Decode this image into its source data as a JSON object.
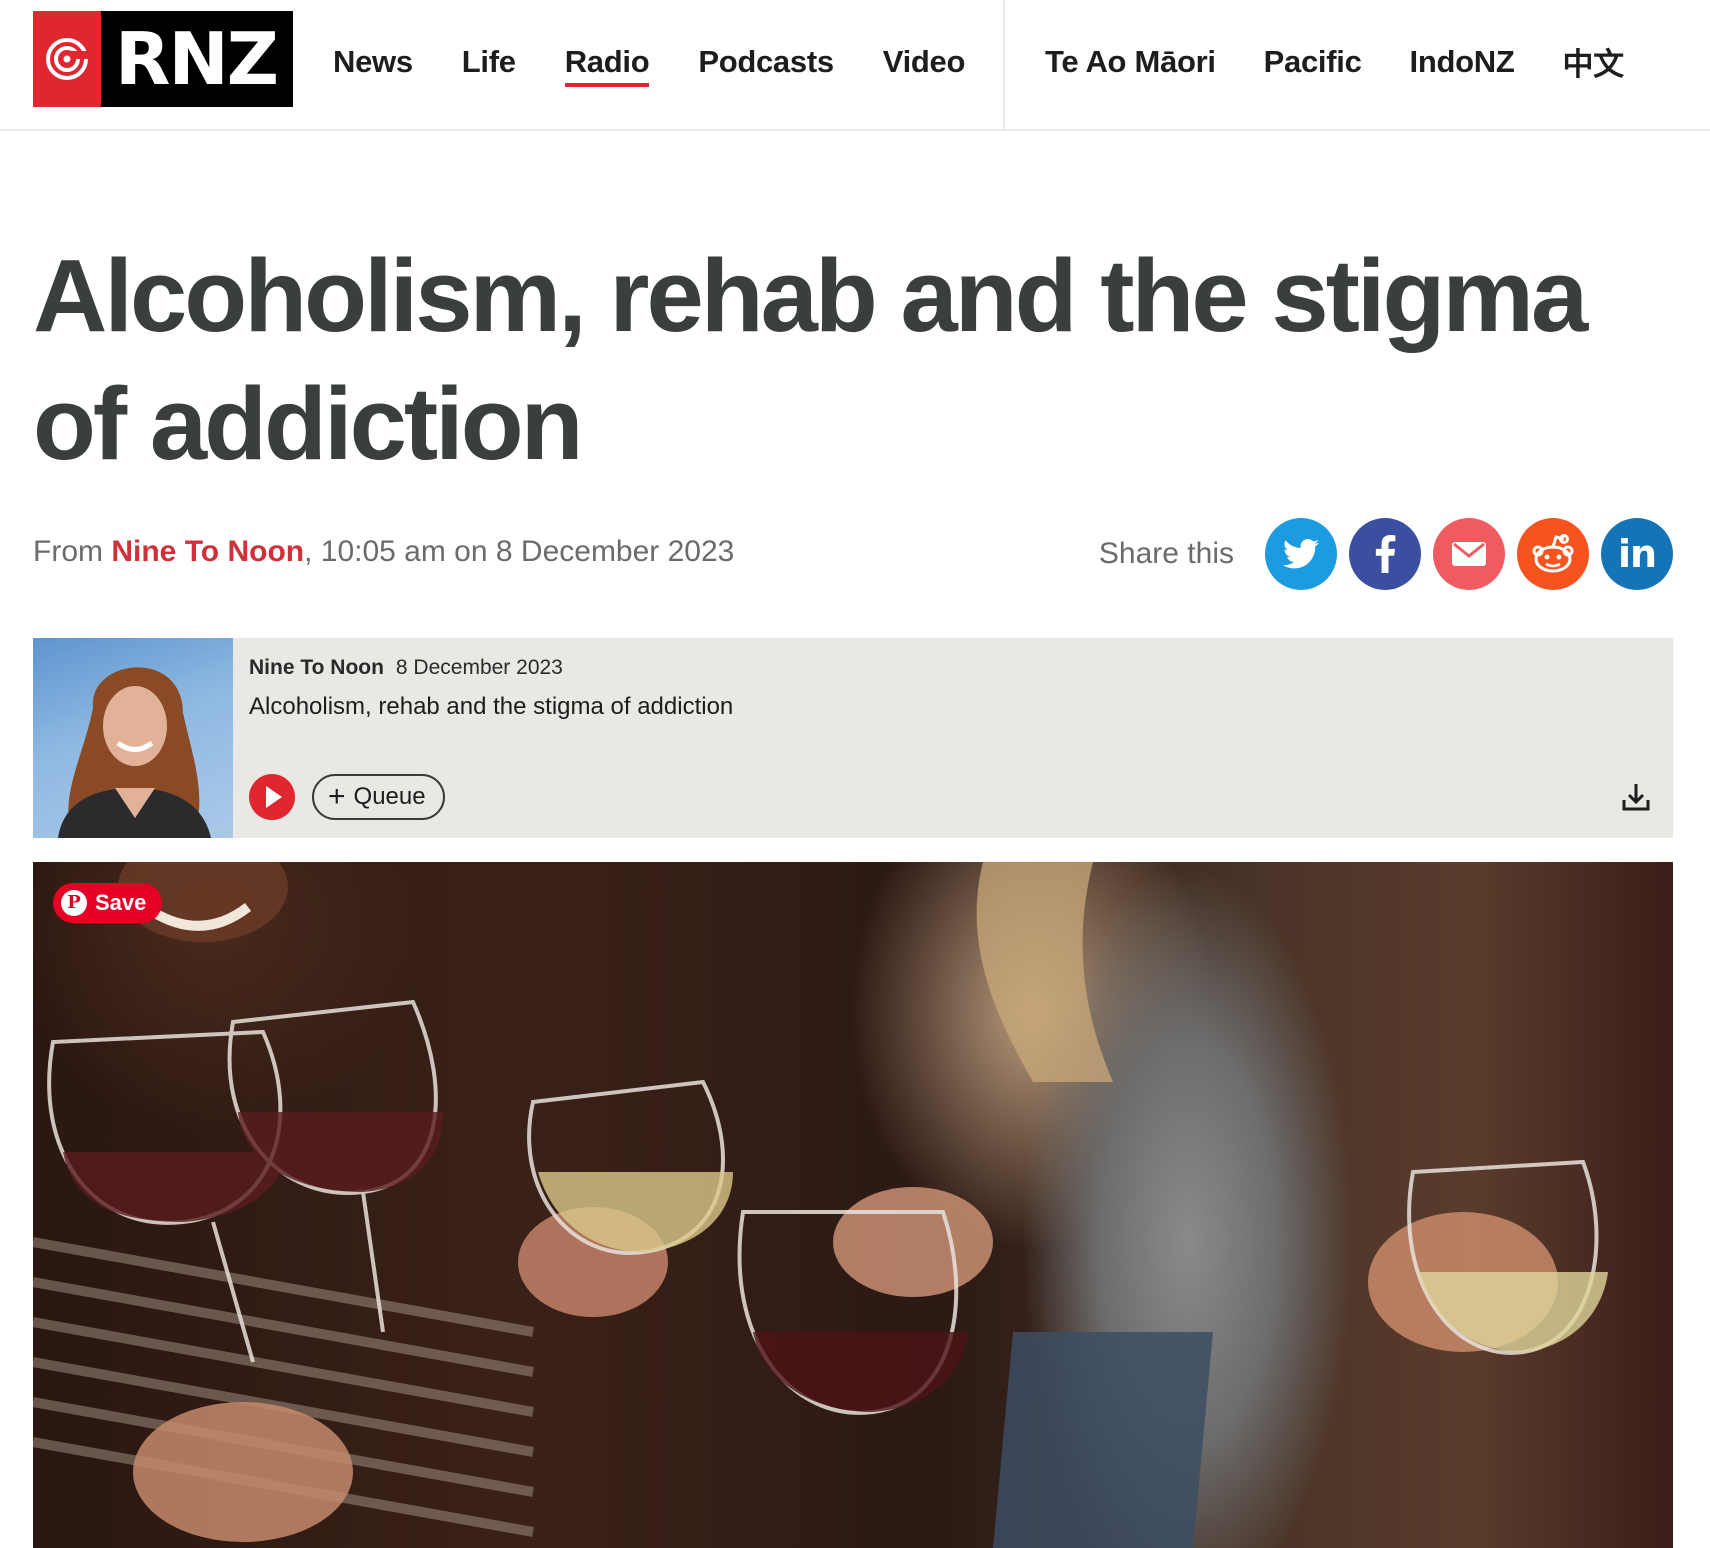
{
  "brand": {
    "logo_text": "RNZ",
    "accent": "#e0262f"
  },
  "nav": {
    "primary": [
      {
        "label": "News",
        "active": false
      },
      {
        "label": "Life",
        "active": false
      },
      {
        "label": "Radio",
        "active": true
      },
      {
        "label": "Podcasts",
        "active": false
      },
      {
        "label": "Video",
        "active": false
      }
    ],
    "secondary": [
      {
        "label": "Te Ao Māori"
      },
      {
        "label": "Pacific"
      },
      {
        "label": "IndoNZ"
      },
      {
        "label": "中文"
      }
    ]
  },
  "article": {
    "title": "Alcoholism, rehab and the stigma of addiction",
    "byline": {
      "from_label": "From",
      "programme": "Nine To Noon",
      "time_date": ", 10:05 am on 8 December 2023"
    },
    "share": {
      "label": "Share this",
      "buttons": [
        {
          "name": "twitter",
          "icon": "twitter-icon",
          "color": "#1c9be0"
        },
        {
          "name": "facebook",
          "icon": "facebook-icon",
          "color": "#3b4ea0"
        },
        {
          "name": "email",
          "icon": "email-icon",
          "color": "#ef5b5f"
        },
        {
          "name": "reddit",
          "icon": "reddit-icon",
          "color": "#f6541f"
        },
        {
          "name": "linkedin",
          "icon": "linkedin-icon",
          "color": "#1474b7"
        }
      ]
    }
  },
  "player": {
    "programme": "Nine To Noon",
    "date": "8 December 2023",
    "title": "Alcoholism, rehab and the stigma of addiction",
    "queue_label": "Queue"
  },
  "hero": {
    "save_label": "Save"
  }
}
